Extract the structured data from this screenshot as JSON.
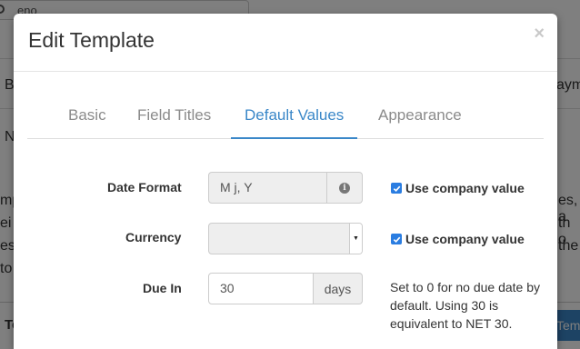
{
  "background": {
    "search_text": "eno",
    "letters": [
      "B",
      "N",
      "ayme",
      "mp",
      "es, a",
      "ei",
      "th o",
      "es",
      "the",
      "to",
      "Te"
    ],
    "footer_button": "Templ"
  },
  "modal": {
    "title": "Edit Template",
    "close_glyph": "×",
    "tabs": [
      {
        "label": "Basic"
      },
      {
        "label": "Field Titles"
      },
      {
        "label": "Default Values"
      },
      {
        "label": "Appearance"
      }
    ],
    "active_tab": "Default Values",
    "accent_color": "#3a87c8",
    "fields": {
      "date_format": {
        "label": "Date Format",
        "value": "M j, Y",
        "addon_icon": "info-icon",
        "checkbox_label": "Use company value",
        "checked": true
      },
      "currency": {
        "label": "Currency",
        "value": "",
        "checkbox_label": "Use company value",
        "checked": true
      },
      "due_in": {
        "label": "Due In",
        "value": "30",
        "addon": "days",
        "help": "Set to 0 for no due date by default. Using 30 is equivalent to NET 30."
      }
    }
  }
}
